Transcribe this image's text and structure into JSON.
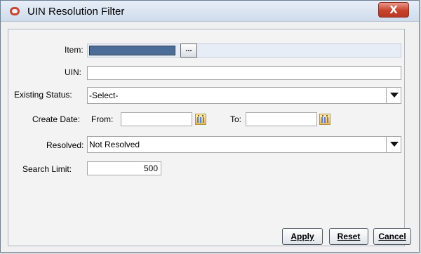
{
  "window": {
    "title": "UIN Resolution Filter",
    "close_label": "X"
  },
  "form": {
    "item_label": "Item:",
    "item_button": "...",
    "uin_label": "UIN:",
    "uin_value": "",
    "existing_status_label": "Existing Status:",
    "existing_status_value": "-Select-",
    "create_date_label": "Create Date:",
    "from_label": "From:",
    "from_value": "",
    "to_label": "To:",
    "to_value": "",
    "resolved_label": "Resolved:",
    "resolved_value": "Not Resolved",
    "search_limit_label": "Search Limit:",
    "search_limit_value": "500"
  },
  "buttons": {
    "apply": "Apply",
    "reset": "Reset",
    "cancel": "Cancel"
  },
  "icons": {
    "app": "oracle-app-icon",
    "close": "close-icon",
    "lookup": "ellipsis-icon",
    "calendar": "calendar-icon",
    "dropdown": "chevron-down-icon"
  },
  "colors": {
    "accent": "#c74634",
    "selection": "#4d6d99"
  }
}
